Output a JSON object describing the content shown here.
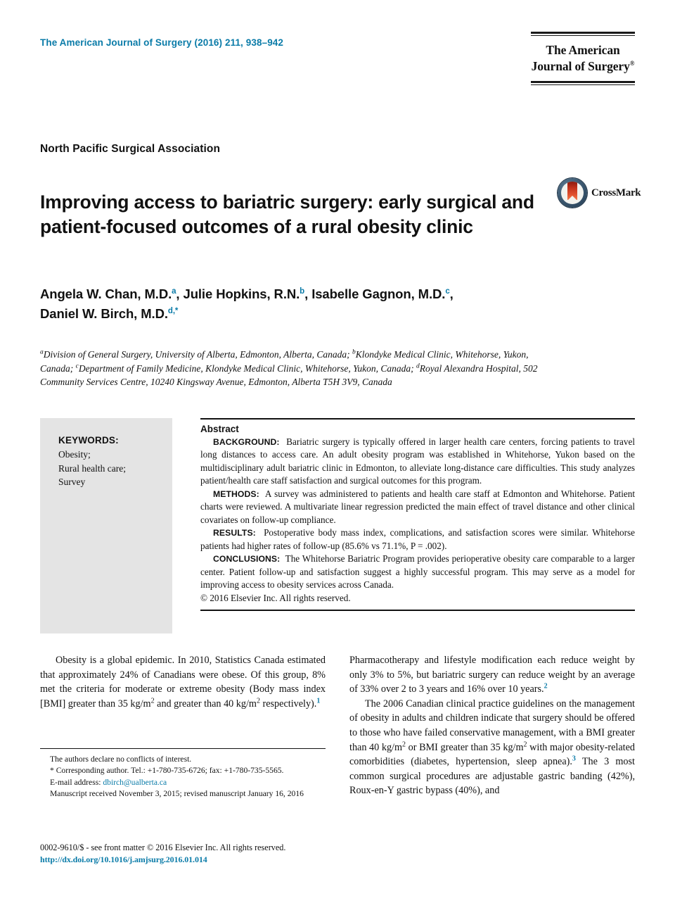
{
  "masthead": {
    "journal_reference": "The American Journal of Surgery (2016) 211, 938–942",
    "logo_line1": "The American",
    "logo_line2": "Journal of Surgery",
    "logo_registered": "®"
  },
  "society": "North Pacific Surgical Association",
  "article": {
    "title": "Improving access to bariatric surgery: early surgical and patient-focused outcomes of a rural obesity clinic",
    "crossmark_label": "CrossMark",
    "authors_line1": "Angela W. Chan, M.D.",
    "authors_sup_a": "a",
    "authors_mid1": ", Julie Hopkins, R.N.",
    "authors_sup_b": "b",
    "authors_mid2": ", Isabelle Gagnon, M.D.",
    "authors_sup_c": "c",
    "authors_mid3": ",",
    "authors_line2": "Daniel W. Birch, M.D.",
    "authors_sup_d": "d,*",
    "affiliations": [
      {
        "marker": "a",
        "text": "Division of General Surgery, University of Alberta, Edmonton, Alberta, Canada; "
      },
      {
        "marker": "b",
        "text": "Klondyke Medical Clinic, Whitehorse, Yukon, Canada; "
      },
      {
        "marker": "c",
        "text": "Department of Family Medicine, Klondyke Medical Clinic, Whitehorse, Yukon, Canada; "
      },
      {
        "marker": "d",
        "text": "Royal Alexandra Hospital, 502 Community Services Centre, 10240 Kingsway Avenue, Edmonton, Alberta T5H 3V9, Canada"
      }
    ]
  },
  "keywords": {
    "heading": "KEYWORDS:",
    "items": [
      "Obesity;",
      "Rural health care;",
      "Survey"
    ]
  },
  "abstract": {
    "heading": "Abstract",
    "sections": [
      {
        "label": "BACKGROUND:",
        "text": "Bariatric surgery is typically offered in larger health care centers, forcing patients to travel long distances to access care. An adult obesity program was established in Whitehorse, Yukon based on the multidisciplinary adult bariatric clinic in Edmonton, to alleviate long-distance care difficulties. This study analyzes patient/health care staff satisfaction and surgical outcomes for this program."
      },
      {
        "label": "METHODS:",
        "text": "A survey was administered to patients and health care staff at Edmonton and Whitehorse. Patient charts were reviewed. A multivariate linear regression predicted the main effect of travel distance and other clinical covariates on follow-up compliance."
      },
      {
        "label": "RESULTS:",
        "text": "Postoperative body mass index, complications, and satisfaction scores were similar. Whitehorse patients had higher rates of follow-up (85.6% vs 71.1%, P = .002)."
      },
      {
        "label": "CONCLUSIONS:",
        "text": "The Whitehorse Bariatric Program provides perioperative obesity care comparable to a larger center. Patient follow-up and satisfaction suggest a highly successful program. This may serve as a model for improving access to obesity services across Canada."
      }
    ],
    "copyright": "© 2016 Elsevier Inc. All rights reserved."
  },
  "body": {
    "left_paragraph_1_part1": "Obesity is a global epidemic. In 2010, Statistics Canada estimated that approximately 24% of Canadians were obese. Of this group, 8% met the criteria for moderate or extreme obesity (Body mass index [BMI] greater than 35 kg/m",
    "left_paragraph_1_sup1": "2",
    "left_paragraph_1_part2": " and greater than 40 kg/m",
    "left_paragraph_1_sup2": "2",
    "left_paragraph_1_part3": " respectively).",
    "left_paragraph_1_ref": "1",
    "right_paragraph_1_part1": "Pharmacotherapy and lifestyle modification each reduce weight by only 3% to 5%, but bariatric surgery can reduce weight by an average of 33% over 2 to 3 years and 16% over 10 years.",
    "right_paragraph_1_ref": "2",
    "right_paragraph_2_part1": "The 2006 Canadian clinical practice guidelines on the management of obesity in adults and children indicate that surgery should be offered to those who have failed conservative management, with a BMI greater than 40 kg/m",
    "right_paragraph_2_sup1": "2",
    "right_paragraph_2_part2": " or BMI greater than 35 kg/m",
    "right_paragraph_2_sup2": "2",
    "right_paragraph_2_part3": " with major obesity-related comorbidities (diabetes, hypertension, sleep apnea).",
    "right_paragraph_2_ref": "3",
    "right_paragraph_2_part4": " The 3 most common surgical procedures are adjustable gastric banding (42%), Roux-en-Y gastric bypass (40%), and"
  },
  "footnotes": {
    "conflict": "The authors declare no conflicts of interest.",
    "corresponding": "* Corresponding author. Tel.: +1-780-735-6726; fax: +1-780-735-5565.",
    "email_label": "E-mail address:",
    "email": "dbirch@ualberta.ca",
    "manuscript": "Manuscript received November 3, 2015; revised manuscript January 16, 2016"
  },
  "page_footer": {
    "front_matter": "0002-9610/$ - see front matter © 2016 Elsevier Inc. All rights reserved.",
    "doi": "http://dx.doi.org/10.1016/j.amjsurg.2016.01.014"
  },
  "colors": {
    "accent": "#0a7ba8",
    "keyword_box": "#e4e4e4",
    "text": "#111111"
  }
}
